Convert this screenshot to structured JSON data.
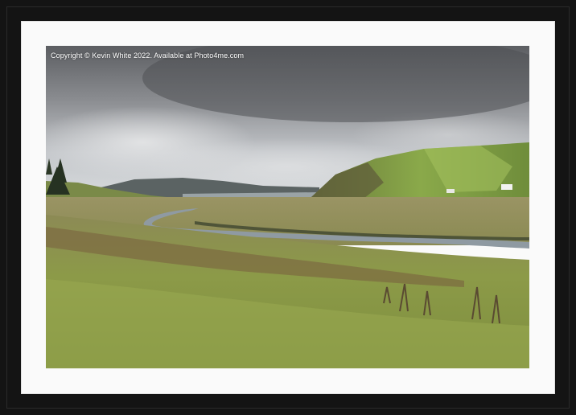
{
  "photo": {
    "copyright": "Copyright © Kevin White 2022. Available at Photo4me.com"
  },
  "frame": {
    "frame_color": "#141414",
    "mount_color": "#fafafa"
  },
  "scene": {
    "sky_color": "#8a8c90",
    "hill_color": "#7f9a45",
    "river_color": "#8f9aa2",
    "grass_color": "#8c9a48"
  }
}
